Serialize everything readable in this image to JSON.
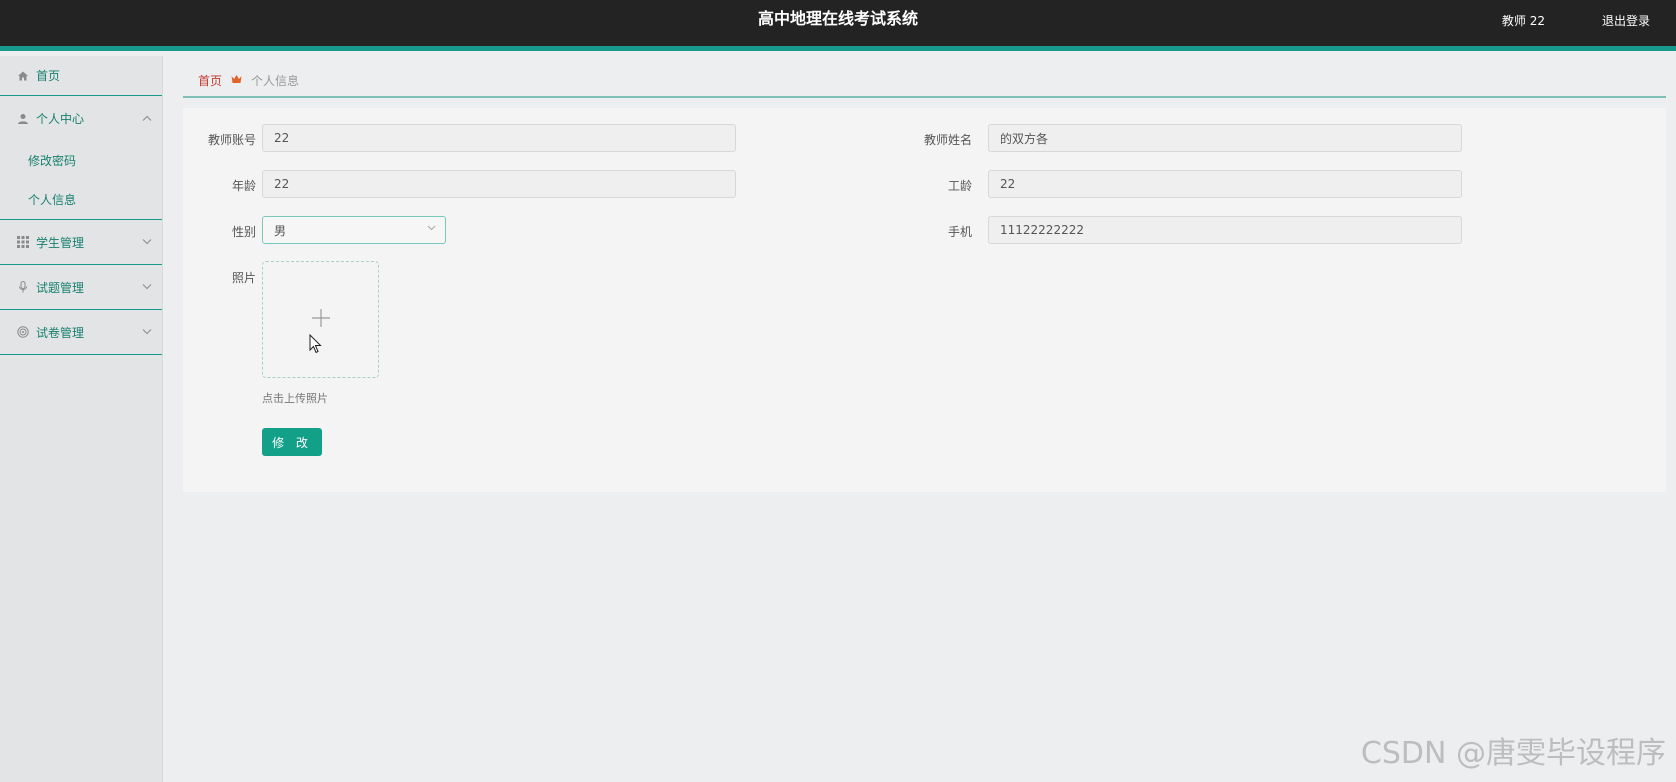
{
  "header": {
    "title": "高中地理在线考试系统",
    "user": "教师 22",
    "logout": "退出登录"
  },
  "sidebar": {
    "home": "首页",
    "personal_center": "个人中心",
    "change_password": "修改密码",
    "personal_info": "个人信息",
    "student_mgmt": "学生管理",
    "question_mgmt": "试题管理",
    "paper_mgmt": "试卷管理"
  },
  "breadcrumb": {
    "home": "首页",
    "current": "个人信息"
  },
  "form": {
    "account_label": "教师账号",
    "account_value": "22",
    "name_label": "教师姓名",
    "name_value": "的双方各",
    "age_label": "年龄",
    "age_value": "22",
    "seniority_label": "工龄",
    "seniority_value": "22",
    "gender_label": "性别",
    "gender_value": "男",
    "phone_label": "手机",
    "phone_value": "11122222222",
    "photo_label": "照片",
    "upload_tip": "点击上传照片",
    "submit": "修 改"
  },
  "watermark": "CSDN @唐雯毕设程序",
  "colors": {
    "header_bg": "#232323",
    "accent": "#17998c",
    "button": "#13a089",
    "breadcrumb_home": "#c43a2f"
  }
}
